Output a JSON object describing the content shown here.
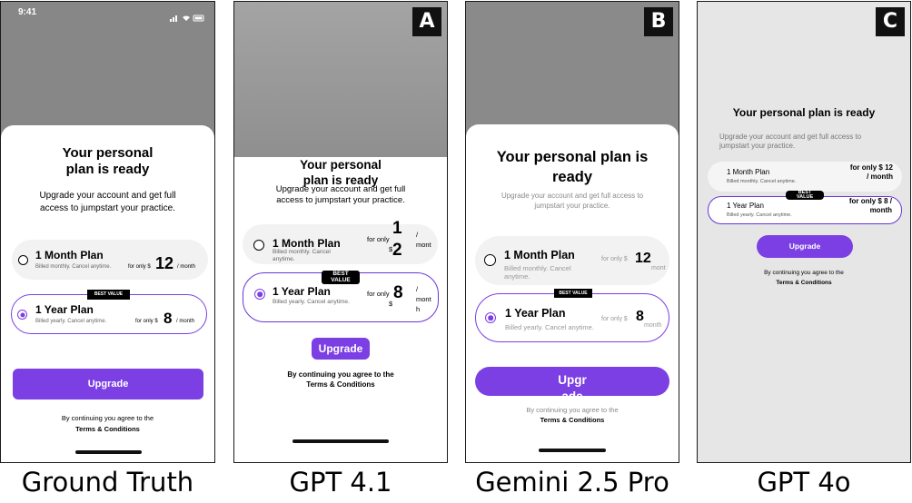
{
  "captions": [
    "Ground Truth",
    "GPT 4.1",
    "Gemini 2.5 Pro",
    "GPT 4o"
  ],
  "badges": {
    "a": "A",
    "b": "B",
    "c": "C"
  },
  "status_time": "9:41",
  "title_line1": "Your personal",
  "title_line2": "plan is ready",
  "title_full": "Your personal plan is ready",
  "title_gemini_1": "Your personal plan is",
  "title_gemini_2": "ready",
  "subtitle": "Upgrade your account and get full access to jumpstart your practice.",
  "month_plan": {
    "name": "1 Month Plan",
    "desc": "Billed monthly. Cancel anytime.",
    "for_only": "for only $",
    "price": "12",
    "per": "/ month"
  },
  "year_plan": {
    "name": "1 Year Plan",
    "desc": "Billed yearly. Cancel anytime.",
    "for_only": "for only $",
    "price": "8",
    "per": "/ month"
  },
  "best_value": "BEST VALUE",
  "upgrade": "Upgrade",
  "agree": "By continuing you agree to the",
  "terms": "Terms & Conditions",
  "gpt41": {
    "for_only_a": "for only",
    "for_only_b": "$",
    "month_p1": "1",
    "month_p2": "2",
    "year_p": "8",
    "per_a": "/",
    "per_b": "mont",
    "per_c": "h",
    "best_a": "BEST",
    "best_b": "VALUE"
  },
  "gemini": {
    "for_only": "for only $",
    "month_price": "12",
    "month_per": "mont",
    "year_price": "8",
    "year_per": "month",
    "desc_a": "Billed monthly. Cancel",
    "desc_b": "anytime.",
    "upgrade_a": "Upgr",
    "upgrade_b": "ade"
  },
  "gpt4o": {
    "month_price_a": "for only $ 12",
    "month_price_b": "/ month",
    "year_price_a": "for only $ 8 /",
    "year_price_b": "month",
    "best_a": "BEST",
    "best_b": "VALUE"
  }
}
